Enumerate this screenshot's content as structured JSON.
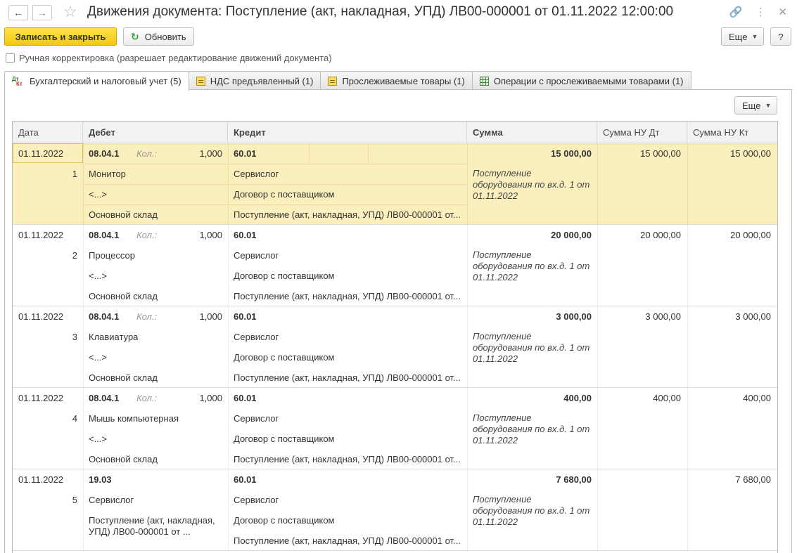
{
  "window": {
    "title": "Движения документа: Поступление (акт, накладная, УПД) ЛВ00-000001 от 01.11.2022 12:00:00"
  },
  "toolbar": {
    "save_close_label": "Записать и закрыть",
    "refresh_label": "Обновить",
    "more_label": "Еще",
    "help_label": "?"
  },
  "manual_edit": {
    "label": "Ручная корректировка (разрешает редактирование движений документа)",
    "checked": false
  },
  "tabs": [
    {
      "label": "Бухгалтерский и налоговый учет (5)",
      "icon": "dt-kt-icon",
      "active": true
    },
    {
      "label": "НДС предъявленный (1)",
      "icon": "register-icon"
    },
    {
      "label": "Прослеживаемые товары (1)",
      "icon": "register-icon"
    },
    {
      "label": "Операции с прослеживаемыми товарами (1)",
      "icon": "table-icon"
    }
  ],
  "panel": {
    "more_label": "Еще"
  },
  "grid": {
    "columns": {
      "date": "Дата",
      "debit": "Дебет",
      "credit": "Кредит",
      "sum": "Сумма",
      "sum_nu_dt": "Сумма НУ Дт",
      "sum_nu_kt": "Сумма НУ Кт"
    },
    "qty_label": "Кол.:",
    "rows": [
      {
        "date": "01.11.2022",
        "num": "1",
        "dt_account": "08.04.1",
        "qty": "1,000",
        "dt_sub1": "Монитор",
        "dt_sub2": "<...>",
        "dt_sub3": "Основной склад",
        "kt_account": "60.01",
        "kt_sub1": "Сервислог",
        "kt_sub2": "Договор с поставщиком",
        "kt_sub3": "Поступление (акт, накладная, УПД) ЛВ00-000001 от...",
        "sum": "15 000,00",
        "content_1": "Поступление",
        "content_2": "оборудования по вх.д. 1 от",
        "content_3": "01.11.2022",
        "nu_dt": "15 000,00",
        "nu_kt": "15 000,00",
        "selected": true
      },
      {
        "date": "01.11.2022",
        "num": "2",
        "dt_account": "08.04.1",
        "qty": "1,000",
        "dt_sub1": "Процессор",
        "dt_sub2": "<...>",
        "dt_sub3": "Основной склад",
        "kt_account": "60.01",
        "kt_sub1": "Сервислог",
        "kt_sub2": "Договор с поставщиком",
        "kt_sub3": "Поступление (акт, накладная, УПД) ЛВ00-000001 от...",
        "sum": "20 000,00",
        "content_1": "Поступление",
        "content_2": "оборудования по вх.д. 1 от",
        "content_3": "01.11.2022",
        "nu_dt": "20 000,00",
        "nu_kt": "20 000,00"
      },
      {
        "date": "01.11.2022",
        "num": "3",
        "dt_account": "08.04.1",
        "qty": "1,000",
        "dt_sub1": "Клавиатура",
        "dt_sub2": "<...>",
        "dt_sub3": "Основной склад",
        "kt_account": "60.01",
        "kt_sub1": "Сервислог",
        "kt_sub2": "Договор с поставщиком",
        "kt_sub3": "Поступление (акт, накладная, УПД) ЛВ00-000001 от...",
        "sum": "3 000,00",
        "content_1": "Поступление",
        "content_2": "оборудования по вх.д. 1 от",
        "content_3": "01.11.2022",
        "nu_dt": "3 000,00",
        "nu_kt": "3 000,00"
      },
      {
        "date": "01.11.2022",
        "num": "4",
        "dt_account": "08.04.1",
        "qty": "1,000",
        "dt_sub1": "Мышь компьютерная",
        "dt_sub2": "<...>",
        "dt_sub3": "Основной склад",
        "kt_account": "60.01",
        "kt_sub1": "Сервислог",
        "kt_sub2": "Договор с поставщиком",
        "kt_sub3": "Поступление (акт, накладная, УПД) ЛВ00-000001 от...",
        "sum": "400,00",
        "content_1": "Поступление",
        "content_2": "оборудования по вх.д. 1 от",
        "content_3": "01.11.2022",
        "nu_dt": "400,00",
        "nu_kt": "400,00"
      },
      {
        "date": "01.11.2022",
        "num": "5",
        "dt_account": "19.03",
        "qty": "",
        "dt_sub1": "Сервислог",
        "dt_sub2": "Поступление (акт, накладная,",
        "dt_sub3": "УПД) ЛВ00-000001 от ...",
        "kt_account": "60.01",
        "kt_sub1": "Сервислог",
        "kt_sub2": "Договор с поставщиком",
        "kt_sub3": "Поступление (акт, накладная, УПД) ЛВ00-000001 от...",
        "sum": "7 680,00",
        "content_1": "Поступление",
        "content_2": "оборудования по вх.д. 1 от",
        "content_3": "01.11.2022",
        "nu_dt": "",
        "nu_kt": "7 680,00"
      }
    ]
  }
}
